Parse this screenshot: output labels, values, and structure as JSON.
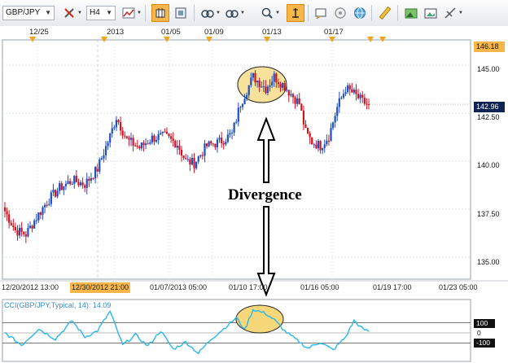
{
  "toolbar": {
    "symbol": "GBP/JPY",
    "timeframe": "H4",
    "tools": [
      "crosshair-delete-icon",
      "line-chart-icon",
      "candlestick-icon",
      "zoom-fit-icon",
      "indicator-icon",
      "objects-icon",
      "zoom-icon",
      "cursor-tool-icon",
      "settings-icon",
      "objects-list-icon",
      "globe-icon",
      "ruler-icon",
      "screenshot-icon",
      "image-icon",
      "draw-icon"
    ],
    "active_tools": [
      "candlestick-icon",
      "cursor-tool-icon"
    ]
  },
  "top_dates": [
    "12/25",
    "2013",
    "01/05",
    "01/09",
    "01/13",
    "01/17"
  ],
  "price_axis": {
    "labels": [
      "145.00",
      "142.50",
      "140.00",
      "137.50",
      "135.00"
    ],
    "high_tag": "146.18",
    "current_tag": "142.96"
  },
  "time_axis": {
    "labels": [
      "12/20/2012 13:00",
      "01/07/2013 05:00",
      "01/10 17:00",
      "01/16 05:00",
      "01/19 17:00",
      "01/23 05:00"
    ],
    "highlighted_label": "12/30/2012 21:00"
  },
  "annotation": {
    "text": "Divergence"
  },
  "cci": {
    "title": "CCI(GBP/JPY,Typical, 14): 14.09",
    "levels": [
      "100",
      "0",
      "-100"
    ]
  },
  "colors": {
    "up_candle": "#1f4fc2",
    "down_candle": "#d4121f",
    "cci_line": "#29b6e8",
    "highlight": "#f6d77a",
    "accent": "#f7b64a"
  },
  "chart_data": [
    {
      "type": "candlestick",
      "title": "",
      "symbol": "GBP/JPY",
      "timeframe": "H4",
      "ylim": [
        134.2,
        146.6
      ],
      "y_ticks": [
        135.0,
        137.5,
        140.0,
        142.5,
        145.0
      ],
      "last_price": 142.96,
      "high": 146.18,
      "x_tick_labels": [
        "12/20/2012 13:00",
        "12/30/2012 21:00",
        "01/07/2013 05:00",
        "01/10 17:00",
        "01/16 05:00",
        "01/19 17:00",
        "01/23 05:00"
      ],
      "close_path_anchors": [
        [
          0,
          137.4
        ],
        [
          5,
          136.4
        ],
        [
          10,
          136.2
        ],
        [
          14,
          136.9
        ],
        [
          20,
          137.9
        ],
        [
          26,
          138.6
        ],
        [
          32,
          139.0
        ],
        [
          38,
          138.8
        ],
        [
          44,
          139.6
        ],
        [
          50,
          141.3
        ],
        [
          53,
          142.3
        ],
        [
          58,
          141.1
        ],
        [
          64,
          140.7
        ],
        [
          70,
          141.2
        ],
        [
          76,
          141.3
        ],
        [
          82,
          140.9
        ],
        [
          86,
          140.0
        ],
        [
          90,
          139.9
        ],
        [
          96,
          140.8
        ],
        [
          102,
          141.0
        ],
        [
          108,
          141.4
        ],
        [
          112,
          143.0
        ],
        [
          118,
          144.4
        ],
        [
          124,
          143.8
        ],
        [
          128,
          144.4
        ],
        [
          133,
          143.9
        ],
        [
          136,
          143.5
        ],
        [
          140,
          143.0
        ],
        [
          143,
          141.5
        ],
        [
          146,
          141.0
        ],
        [
          150,
          140.8
        ],
        [
          154,
          141.3
        ],
        [
          158,
          142.8
        ],
        [
          162,
          143.8
        ],
        [
          166,
          143.5
        ],
        [
          170,
          143.1
        ],
        [
          173,
          142.9
        ]
      ]
    },
    {
      "type": "line",
      "title": "CCI(GBP/JPY,Typical, 14): 14.09",
      "ylim": [
        -250,
        250
      ],
      "levels": [
        100,
        0,
        -100
      ],
      "last_value": 14.09,
      "anchors": [
        [
          0,
          0
        ],
        [
          8,
          -120
        ],
        [
          16,
          40
        ],
        [
          24,
          -60
        ],
        [
          32,
          120
        ],
        [
          38,
          -40
        ],
        [
          44,
          20
        ],
        [
          50,
          210
        ],
        [
          56,
          -120
        ],
        [
          62,
          -20
        ],
        [
          68,
          -130
        ],
        [
          74,
          20
        ],
        [
          80,
          -160
        ],
        [
          86,
          -90
        ],
        [
          92,
          -200
        ],
        [
          98,
          -60
        ],
        [
          104,
          40
        ],
        [
          110,
          150
        ],
        [
          114,
          30
        ],
        [
          118,
          230
        ],
        [
          124,
          190
        ],
        [
          128,
          130
        ],
        [
          133,
          20
        ],
        [
          138,
          -60
        ],
        [
          144,
          -150
        ],
        [
          150,
          -90
        ],
        [
          156,
          -170
        ],
        [
          162,
          -40
        ],
        [
          166,
          120
        ],
        [
          170,
          40
        ],
        [
          173,
          14
        ]
      ]
    }
  ]
}
